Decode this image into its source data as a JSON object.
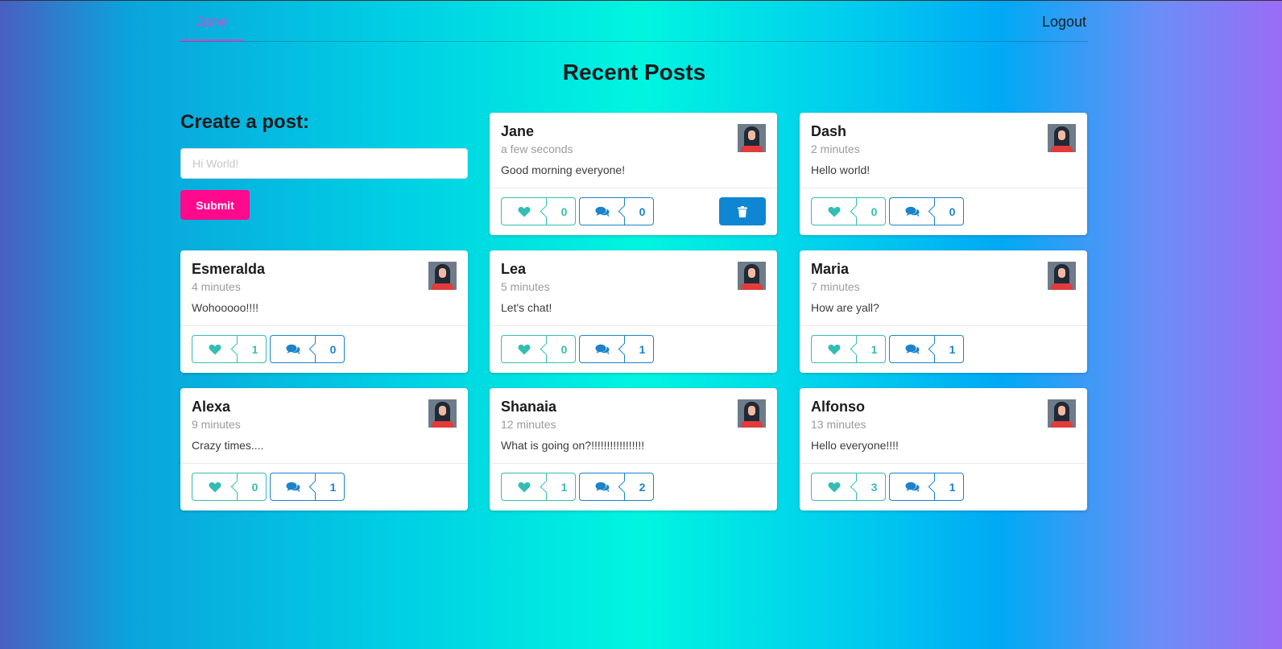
{
  "nav": {
    "user_label": "Jane",
    "logout_label": "Logout"
  },
  "page": {
    "title": "Recent Posts"
  },
  "create": {
    "title": "Create a post:",
    "placeholder": "Hi World!",
    "submit_label": "Submit"
  },
  "colors": {
    "accent_pink": "#ff0a8c",
    "like_teal": "#35bdb2",
    "comment_blue": "#1b83c9",
    "delete_blue": "#0f86d1"
  },
  "posts": [
    {
      "author": "Jane",
      "time": "a few seconds",
      "text": "Good morning everyone!",
      "likes": "0",
      "comments": "0",
      "can_delete": true
    },
    {
      "author": "Dash",
      "time": "2 minutes",
      "text": "Hello world!",
      "likes": "0",
      "comments": "0"
    },
    {
      "author": "Esmeralda",
      "time": "4 minutes",
      "text": "Wohooooo!!!!",
      "likes": "1",
      "comments": "0"
    },
    {
      "author": "Lea",
      "time": "5 minutes",
      "text": "Let's chat!",
      "likes": "0",
      "comments": "1"
    },
    {
      "author": "Maria",
      "time": "7 minutes",
      "text": "How are yall?",
      "likes": "1",
      "comments": "1"
    },
    {
      "author": "Alexa",
      "time": "9 minutes",
      "text": "Crazy times....",
      "likes": "0",
      "comments": "1"
    },
    {
      "author": "Shanaia",
      "time": "12 minutes",
      "text": "What is going on?!!!!!!!!!!!!!!!!!",
      "likes": "1",
      "comments": "2"
    },
    {
      "author": "Alfonso",
      "time": "13 minutes",
      "text": "Hello everyone!!!!",
      "likes": "3",
      "comments": "1"
    }
  ]
}
